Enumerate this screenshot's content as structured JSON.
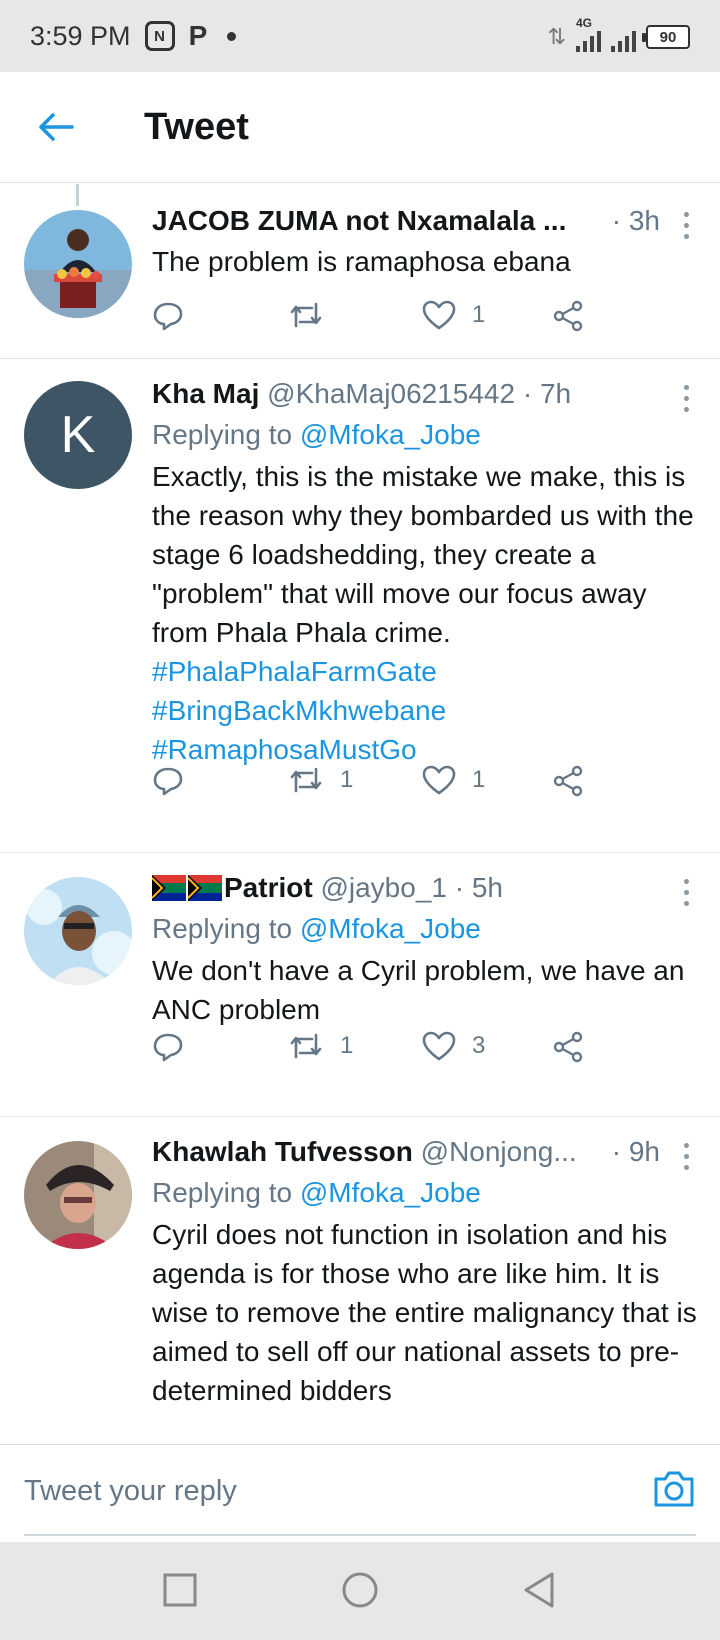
{
  "status_bar": {
    "time": "3:59 PM",
    "notif_badge": "N",
    "notif_p": "P",
    "network": "4G",
    "battery": "90"
  },
  "header": {
    "title": "Tweet"
  },
  "tweets": [
    {
      "name": "JACOB ZUMA not Nxamalala ...",
      "handle": "",
      "time": "· 3h",
      "reply_to_prefix": "",
      "reply_to_handle": "",
      "text": "The problem is ramaphosa ebana",
      "hashtags": [],
      "retweets": "",
      "likes": "1"
    },
    {
      "name": "Kha Maj",
      "handle": "@KhaMaj06215442 · 7h",
      "time": "",
      "avatar_letter": "K",
      "reply_to_prefix": "Replying to ",
      "reply_to_handle": "@Mfoka_Jobe",
      "text": "Exactly, this is the mistake we make, this is the reason why they bombarded us with the stage 6 loadshedding, they create a \"problem\" that will move our focus away from Phala Phala crime.",
      "hashtags": [
        "#PhalaPhalaFarmGate",
        "#BringBackMkhwebane",
        "#RamaphosaMustGo"
      ],
      "retweets": "1",
      "likes": "1"
    },
    {
      "name": "Patriot",
      "handle": "@jaybo_1 · 5h",
      "time": "",
      "reply_to_prefix": "Replying to ",
      "reply_to_handle": "@Mfoka_Jobe",
      "text": "We don't have a Cyril problem, we have an ANC problem",
      "hashtags": [],
      "retweets": "1",
      "likes": "3"
    },
    {
      "name": "Khawlah Tufvesson",
      "handle": "@Nonjong...",
      "time": "· 9h",
      "reply_to_prefix": "Replying to ",
      "reply_to_handle": "@Mfoka_Jobe",
      "text": "Cyril does not function in isolation and his agenda is for those who are like him. It is wise to remove the entire malignancy that is aimed to sell off our national assets to  pre-determined bidders",
      "hashtags": [],
      "retweets": "",
      "likes": ""
    }
  ],
  "reply_bar": {
    "placeholder": "Tweet your reply"
  },
  "icons": {
    "back": "arrow-left-icon",
    "more": "more-vertical-icon",
    "reply": "reply-icon",
    "retweet": "retweet-icon",
    "like": "heart-icon",
    "share": "share-icon",
    "camera": "camera-icon",
    "flag": "south-africa-flag-icon"
  },
  "colors": {
    "accent": "#1b95e0",
    "text": "#14171a",
    "secondary": "#657786",
    "status_bar": "#e8e6e9",
    "avatar_k": "#3e5565"
  }
}
